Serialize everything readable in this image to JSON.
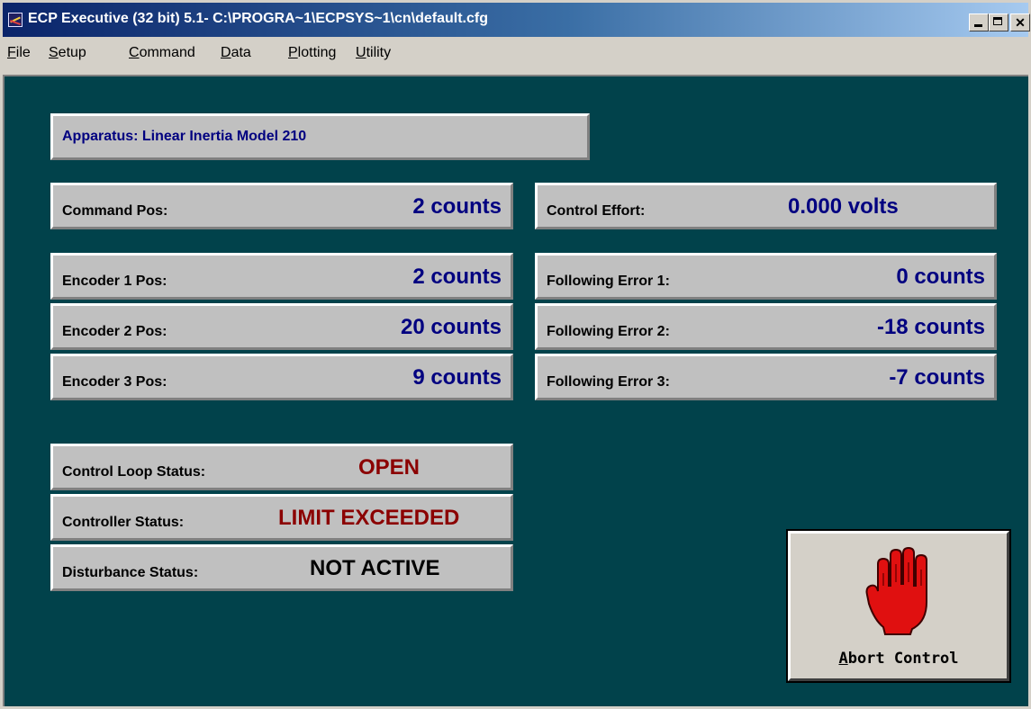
{
  "window": {
    "title": "ECP Executive (32 bit) 5.1- C:\\PROGRA~1\\ECPSYS~1\\cn\\default.cfg"
  },
  "menu": {
    "items": [
      {
        "label": "File"
      },
      {
        "label": "Setup"
      },
      {
        "label": "Command"
      },
      {
        "label": "Data"
      },
      {
        "label": "Plotting"
      },
      {
        "label": "Utility"
      }
    ]
  },
  "apparatus": {
    "label": "Apparatus:  Linear Inertia Model 210"
  },
  "readouts": {
    "command_pos": {
      "label": "Command Pos:",
      "value": "2 counts"
    },
    "encoder1_pos": {
      "label": "Encoder 1 Pos:",
      "value": "2 counts"
    },
    "encoder2_pos": {
      "label": "Encoder 2 Pos:",
      "value": "20 counts"
    },
    "encoder3_pos": {
      "label": "Encoder 3 Pos:",
      "value": "9 counts"
    },
    "control_effort": {
      "label": "Control Effort:",
      "value": "0.000 volts"
    },
    "following_error1": {
      "label": "Following Error 1:",
      "value": "0 counts"
    },
    "following_error2": {
      "label": "Following Error 2:",
      "value": "-18 counts"
    },
    "following_error3": {
      "label": "Following Error 3:",
      "value": "-7 counts"
    }
  },
  "status": {
    "control_loop": {
      "label": "Control Loop Status:",
      "value": "OPEN"
    },
    "controller": {
      "label": "Controller Status:",
      "value": "LIMIT EXCEEDED"
    },
    "disturbance": {
      "label": "Disturbance Status:",
      "value": "NOT ACTIVE"
    }
  },
  "abort": {
    "label_first": "A",
    "label_rest": "bort Control",
    "icon": "stop-hand-icon"
  },
  "colors": {
    "background": "#01424b",
    "panel": "#c0c0c0",
    "value_blue": "#000080",
    "status_red": "#8b0000"
  }
}
